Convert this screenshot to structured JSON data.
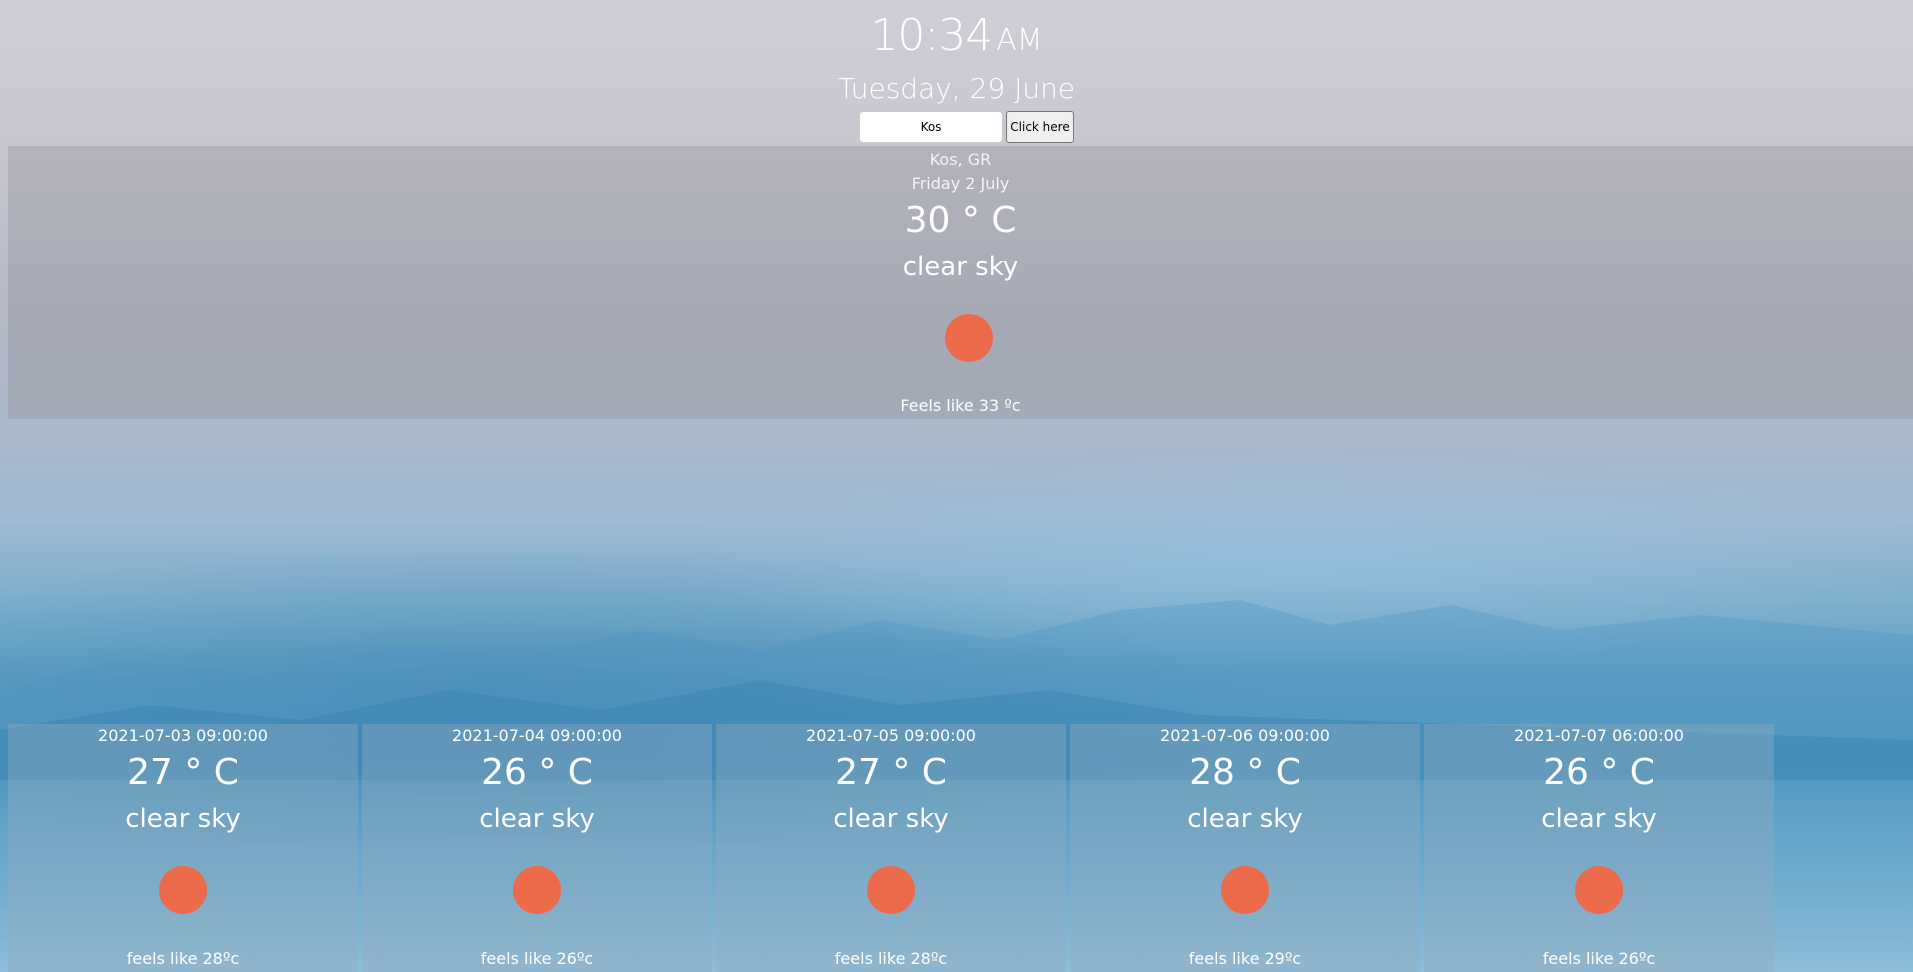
{
  "clock": {
    "time": "10:34",
    "ampm": "AM",
    "date": "Tuesday, 29 June"
  },
  "search": {
    "value": "Kos",
    "button_label": "Click here"
  },
  "current": {
    "location": "Kos, GR",
    "date": "Friday 2 July",
    "temperature": "30 ° C",
    "description": "clear sky",
    "icon": "sun-icon",
    "feels_like": "Feels like 33 ºc"
  },
  "forecast": [
    {
      "datetime": "2021-07-03 09:00:00",
      "temperature": "27 ° C",
      "description": "clear sky",
      "icon": "sun-icon",
      "feels_like": "feels like 28ºc"
    },
    {
      "datetime": "2021-07-04 09:00:00",
      "temperature": "26 ° C",
      "description": "clear sky",
      "icon": "sun-icon",
      "feels_like": "feels like 26ºc"
    },
    {
      "datetime": "2021-07-05 09:00:00",
      "temperature": "27 ° C",
      "description": "clear sky",
      "icon": "sun-icon",
      "feels_like": "feels like 28ºc"
    },
    {
      "datetime": "2021-07-06 09:00:00",
      "temperature": "28 ° C",
      "description": "clear sky",
      "icon": "sun-icon",
      "feels_like": "feels like 29ºc"
    },
    {
      "datetime": "2021-07-07 06:00:00",
      "temperature": "26 ° C",
      "description": "clear sky",
      "icon": "sun-icon",
      "feels_like": "feels like 26ºc"
    }
  ],
  "colors": {
    "sun": "#ec6a4a",
    "panel": "rgba(150,152,162,0.45)"
  }
}
